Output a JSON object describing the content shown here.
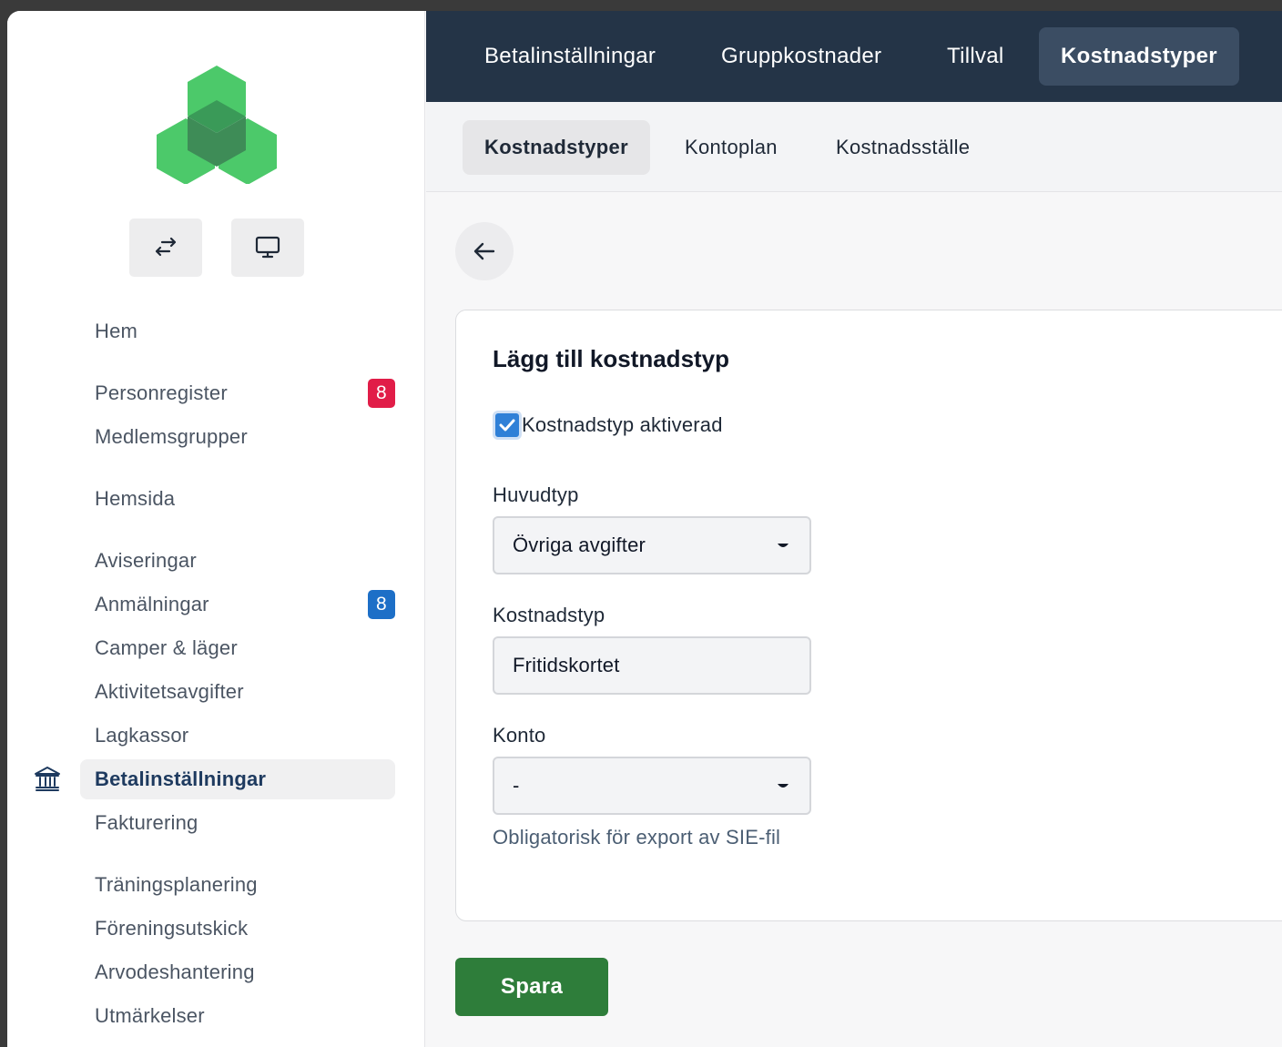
{
  "topbar": {
    "tabs": [
      {
        "label": "Betalinställningar"
      },
      {
        "label": "Gruppkostnader"
      },
      {
        "label": "Tillval"
      },
      {
        "label": "Kostnadstyper"
      }
    ]
  },
  "subbar": {
    "tabs": [
      {
        "label": "Kostnadstyper"
      },
      {
        "label": "Kontoplan"
      },
      {
        "label": "Kostnadsställe"
      }
    ]
  },
  "sidebar": {
    "buttons": {
      "switch": "swap-arrows-icon",
      "display": "monitor-icon"
    },
    "items": [
      {
        "label": "Hem"
      },
      {
        "label": "Personregister",
        "badge": "8",
        "badge_color": "#e11d48"
      },
      {
        "label": "Medlemsgrupper"
      },
      {
        "label": "Hemsida"
      },
      {
        "label": "Aviseringar"
      },
      {
        "label": "Anmälningar",
        "badge": "8",
        "badge_color": "#1d6fc7"
      },
      {
        "label": "Camper & läger"
      },
      {
        "label": "Aktivitetsavgifter"
      },
      {
        "label": "Lagkassor"
      },
      {
        "label": "Betalinställningar",
        "icon": "bank-icon"
      },
      {
        "label": "Fakturering"
      },
      {
        "label": "Träningsplanering"
      },
      {
        "label": "Föreningsutskick"
      },
      {
        "label": "Arvodeshantering"
      },
      {
        "label": "Utmärkelser"
      }
    ]
  },
  "form": {
    "title": "Lägg till kostnadstyp",
    "activated_label": "Kostnadstyp aktiverad",
    "activated": true,
    "huvudtyp": {
      "label": "Huvudtyp",
      "value": "Övriga avgifter"
    },
    "kostnadstyp": {
      "label": "Kostnadstyp",
      "value": "Fritidskortet"
    },
    "konto": {
      "label": "Konto",
      "value": "-",
      "help": "Obligatorisk för export av SIE-fil"
    },
    "save_label": "Spara"
  },
  "colors": {
    "topbar": "#243447",
    "save": "#2e7d3a",
    "checkbox": "#2f80d7"
  }
}
